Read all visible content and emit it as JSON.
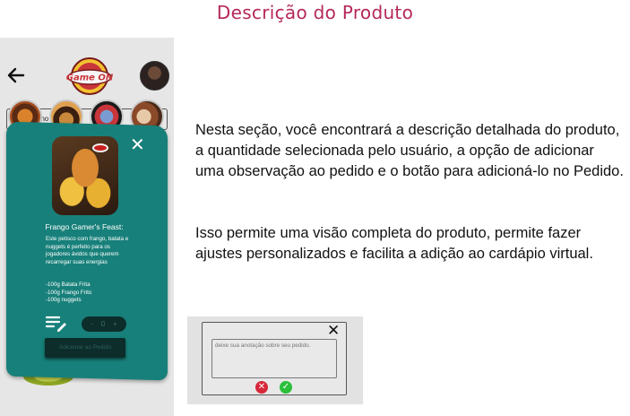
{
  "page": {
    "title": "Descrição do Produto"
  },
  "app": {
    "search_placeholder": "Busque no Cardápio",
    "logo_text": "Game ON",
    "product": {
      "name": "Frango Gamer's Feast:",
      "description": "Este petisco com frango, batata e nuggets é perfeito para os jogadores ávidos que querem recarregar suas energias",
      "items": [
        "-100g Batata Frita",
        "-100g Frango Frito",
        "-100g nuggets"
      ],
      "quantity": "0",
      "minus": "-",
      "plus": "+",
      "add_button_label": "Adicionar ao Pedido"
    }
  },
  "explanation": {
    "paragraph_1": "Nesta seção, você encontrará a descrição detalhada do produto, a quantidade selecionada pelo usuário, a opção de adicionar uma observação ao pedido e o botão para adicioná-lo no Pedido.",
    "paragraph_2": "Isso permite uma visão completa do produto, permite fazer ajustes personalizados e facilita a adição ao cardápio virtual."
  },
  "note_popup": {
    "placeholder": "deixe sua anotação sobre seu pedido."
  },
  "colors": {
    "title": "#b6285a",
    "modal": "#18807a",
    "cancel": "#d62839",
    "confirm": "#2bbf3a"
  },
  "icons": [
    "back-arrow-icon",
    "search-icon",
    "close-icon",
    "edit-note-icon",
    "cancel-icon",
    "confirm-icon"
  ]
}
